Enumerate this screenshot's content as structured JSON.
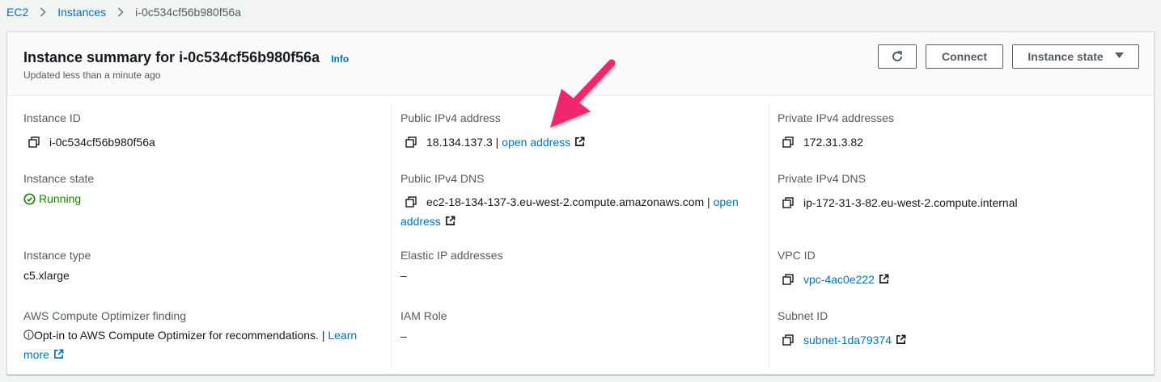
{
  "breadcrumb": {
    "items": [
      "EC2",
      "Instances"
    ],
    "current": "i-0c534cf56b980f56a"
  },
  "header": {
    "title": "Instance summary for i-0c534cf56b980f56a",
    "info_label": "Info",
    "subtitle": "Updated less than a minute ago",
    "connect_label": "Connect",
    "instance_state_label": "Instance state"
  },
  "fields": {
    "instance_id": {
      "label": "Instance ID",
      "value": "i-0c534cf56b980f56a"
    },
    "instance_state": {
      "label": "Instance state",
      "value": "Running"
    },
    "instance_type": {
      "label": "Instance type",
      "value": "c5.xlarge"
    },
    "optimizer": {
      "label": "AWS Compute Optimizer finding",
      "text": "Opt-in to AWS Compute Optimizer for recommendations. |",
      "link_part1": "Learn",
      "link_part2": "more"
    },
    "public_ipv4": {
      "label": "Public IPv4 address",
      "value": "18.134.137.3 |",
      "link": "open address"
    },
    "public_dns": {
      "label": "Public IPv4 DNS",
      "value": "ec2-18-134-137-3.eu-west-2.compute.amazonaws.com |",
      "link_part1": "open",
      "link_part2": "address"
    },
    "elastic_ip": {
      "label": "Elastic IP addresses",
      "value": "–"
    },
    "iam_role": {
      "label": "IAM Role",
      "value": "–"
    },
    "private_ipv4": {
      "label": "Private IPv4 addresses",
      "value": "172.31.3.82"
    },
    "private_dns": {
      "label": "Private IPv4 DNS",
      "value": "ip-172-31-3-82.eu-west-2.compute.internal"
    },
    "vpc_id": {
      "label": "VPC ID",
      "value": "vpc-4ac0e222"
    },
    "subnet_id": {
      "label": "Subnet ID",
      "value": "subnet-1da79374"
    }
  },
  "colors": {
    "link": "#0073bb",
    "running": "#1d8102",
    "annotation_arrow": "#f0286e"
  },
  "icons": [
    "chevron-right-icon",
    "refresh-icon",
    "caret-down-icon",
    "copy-icon",
    "external-link-icon",
    "check-circle-icon",
    "info-circle-icon"
  ]
}
